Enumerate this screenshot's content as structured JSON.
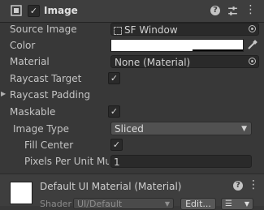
{
  "header": {
    "title": "Image",
    "enabled_glyph": "✓",
    "icons": [
      "image-component-icon",
      "help-icon",
      "preset-icon",
      "context-menu-icon"
    ]
  },
  "fields": {
    "source_image_label": "Source Image",
    "source_image_value": "SF Window",
    "color_label": "Color",
    "color_value": "#ffffff",
    "material_label": "Material",
    "material_value": "None (Material)",
    "raycast_target_label": "Raycast Target",
    "raycast_padding_label": "Raycast Padding",
    "maskable_label": "Maskable",
    "image_type_label": "Image Type",
    "image_type_value": "Sliced",
    "fill_center_label": "Fill Center",
    "pixels_per_unit_label": "Pixels Per Unit Mul",
    "pixels_per_unit_value": "1",
    "check_glyph": "✓"
  },
  "material_footer": {
    "title": "Default UI Material (Material)",
    "shader_label": "Shader",
    "shader_value": "UI/Default",
    "edit_label": "Edit..."
  },
  "colors": {
    "background": "#383838",
    "header": "#3e3e3e",
    "text": "#c4c4c4",
    "field": "#2a2a2a"
  }
}
